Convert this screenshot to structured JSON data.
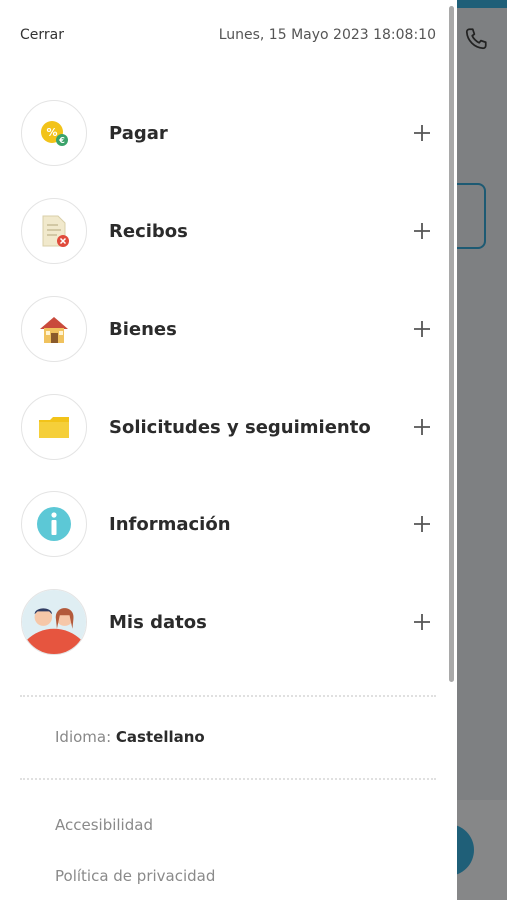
{
  "header": {
    "close_label": "Cerrar",
    "datetime": "Lunes, 15 Mayo 2023 18:08:10"
  },
  "menu": {
    "items": [
      {
        "label": "Pagar",
        "icon": "pay-coin-icon"
      },
      {
        "label": "Recibos",
        "icon": "receipt-icon"
      },
      {
        "label": "Bienes",
        "icon": "house-icon"
      },
      {
        "label": "Solicitudes y seguimiento",
        "icon": "folder-icon"
      },
      {
        "label": "Información",
        "icon": "info-icon"
      },
      {
        "label": "Mis datos",
        "icon": "people-icon"
      }
    ],
    "expand_symbol": "+"
  },
  "language": {
    "label": "Idioma:",
    "value": "Castellano"
  },
  "footer": {
    "links": [
      "Accesibilidad",
      "Política de privacidad"
    ]
  },
  "colors": {
    "accent": "#1f5f78",
    "overlay": "#7e8082",
    "icon_yellow": "#f2c319",
    "icon_cyan": "#5cc8d6",
    "icon_red": "#e04b3c"
  }
}
